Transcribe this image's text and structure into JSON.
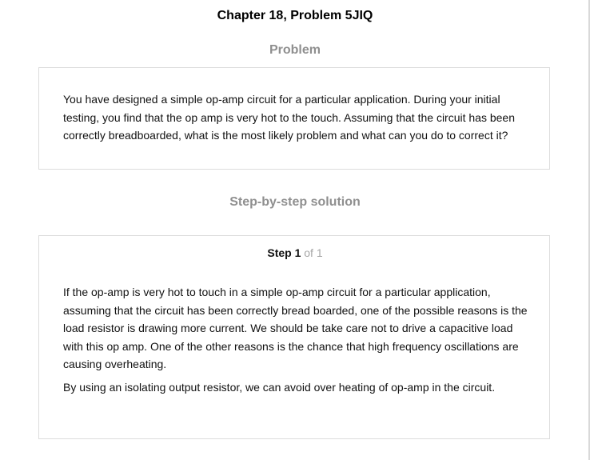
{
  "page_title": "Chapter 18, Problem 5JIQ",
  "problem": {
    "heading": "Problem",
    "text": "You have designed a simple op-amp circuit for a particular application. During your initial testing, you find that the op amp is very hot to the touch. Assuming that the circuit has been correctly breadboarded, what is the most likely problem and what can you do to correct it?"
  },
  "solution": {
    "heading": "Step-by-step solution",
    "step_label": "Step 1",
    "step_of": "of 1",
    "paragraphs": [
      "If the op-amp is very hot to touch in a simple op-amp circuit for a particular application, assuming that the circuit has been correctly bread boarded, one of the possible reasons is the load resistor is drawing more current. We should be take care not to drive a capacitive load with this op amp. One of the other reasons is the chance that high frequency oscillations are causing overheating.",
      "By using an isolating output resistor, we can avoid over heating of op-amp in the circuit."
    ]
  }
}
